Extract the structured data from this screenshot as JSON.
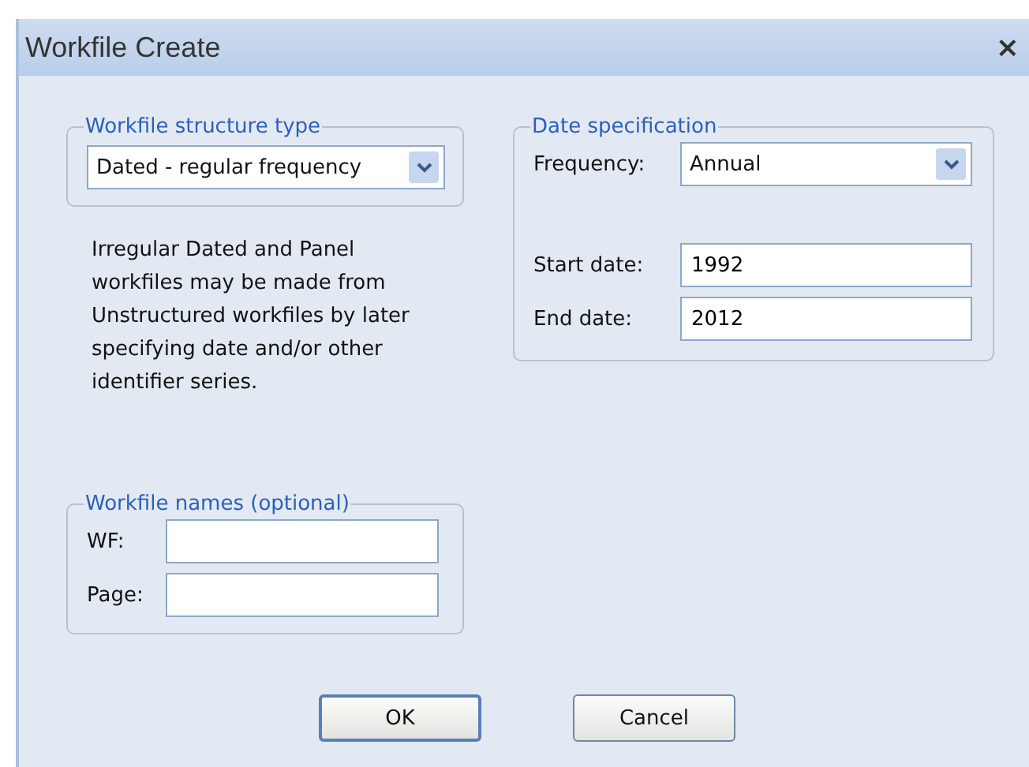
{
  "window": {
    "title": "Workfile Create",
    "close": "×"
  },
  "structure_group": {
    "legend": "Workfile structure type",
    "dropdown": {
      "value": "Dated - regular frequency"
    },
    "note": "Irregular Dated and Panel workfiles may be made from Unstructured workfiles by later specifying date and/or other identifier series."
  },
  "date_group": {
    "legend": "Date specification",
    "fields": [
      {
        "kind": "dropdown",
        "label": "Frequency:",
        "value": "Annual"
      },
      {
        "kind": "text",
        "label": "Start date:",
        "value": "1992"
      },
      {
        "kind": "text",
        "label": "End date:",
        "value": "2012"
      }
    ]
  },
  "names_group": {
    "legend": "Workfile names (optional)",
    "fields": [
      {
        "label": "WF:"
      },
      {
        "label": "Page:"
      }
    ]
  },
  "buttons": [
    {
      "label": "OK",
      "default": true
    },
    {
      "label": "Cancel",
      "default": false
    }
  ]
}
